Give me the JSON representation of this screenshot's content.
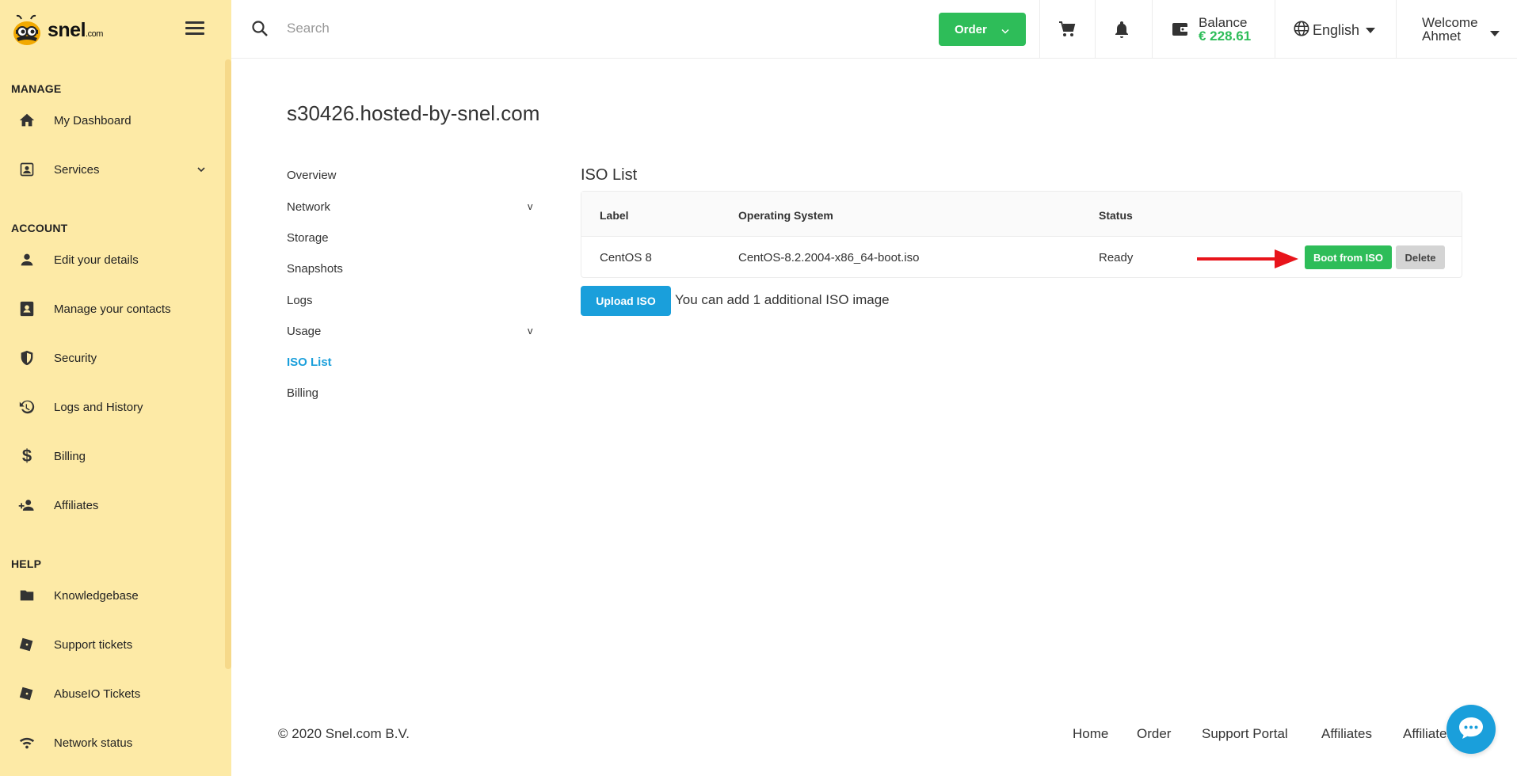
{
  "brand": {
    "logo_text": "snel",
    "logo_suffix": ".com"
  },
  "sidebar": {
    "sections": [
      {
        "title": "MANAGE"
      },
      {
        "title": "ACCOUNT"
      },
      {
        "title": "HELP"
      }
    ],
    "items": [
      {
        "label": "My Dashboard",
        "icon": "home-icon"
      },
      {
        "label": "Services",
        "icon": "id-card-icon"
      },
      {
        "label": "Edit your details",
        "icon": "person-icon"
      },
      {
        "label": "Manage your contacts",
        "icon": "contacts-icon"
      },
      {
        "label": "Security",
        "icon": "shield-icon"
      },
      {
        "label": "Logs and History",
        "icon": "history-icon"
      },
      {
        "label": "Billing",
        "icon": "dollar-icon"
      },
      {
        "label": "Affiliates",
        "icon": "person-add-icon"
      },
      {
        "label": "Knowledgebase",
        "icon": "folder-icon"
      },
      {
        "label": "Support tickets",
        "icon": "ticket-icon"
      },
      {
        "label": "AbuseIO Tickets",
        "icon": "ticket-icon"
      },
      {
        "label": "Network status",
        "icon": "wifi-icon"
      }
    ]
  },
  "header": {
    "search_placeholder": "Search",
    "order_label": "Order",
    "balance_label": "Balance",
    "balance_value": "€ 228.61",
    "language": "English",
    "welcome_line1": "Welcome",
    "welcome_line2": "Ahmet"
  },
  "main": {
    "title": "s30426.hosted-by-snel.com",
    "subnav": [
      {
        "label": "Overview"
      },
      {
        "label": "Network"
      },
      {
        "label": "Storage"
      },
      {
        "label": "Snapshots"
      },
      {
        "label": "Logs"
      },
      {
        "label": "Usage"
      },
      {
        "label": "ISO List"
      },
      {
        "label": "Billing"
      }
    ],
    "subnav_chevron": "v",
    "iso": {
      "title": "ISO List",
      "columns": [
        "Label",
        "Operating System",
        "Status"
      ],
      "rows": [
        {
          "label": "CentOS 8",
          "os": "CentOS-8.2.2004-x86_64-boot.iso",
          "status": "Ready"
        }
      ],
      "boot_label": "Boot from ISO",
      "delete_label": "Delete",
      "upload_label": "Upload ISO",
      "upload_note": "You can add 1 additional ISO image"
    }
  },
  "footer": {
    "copyright": "© 2020 Snel.com B.V.",
    "links": [
      "Home",
      "Order",
      "Support Portal",
      "Affiliates",
      "Affiliates"
    ]
  },
  "colors": {
    "sidebar_bg": "#fdeaa6",
    "green": "#2ebd59",
    "blue": "#1a9fdb",
    "arrow_red": "#e8141b"
  }
}
